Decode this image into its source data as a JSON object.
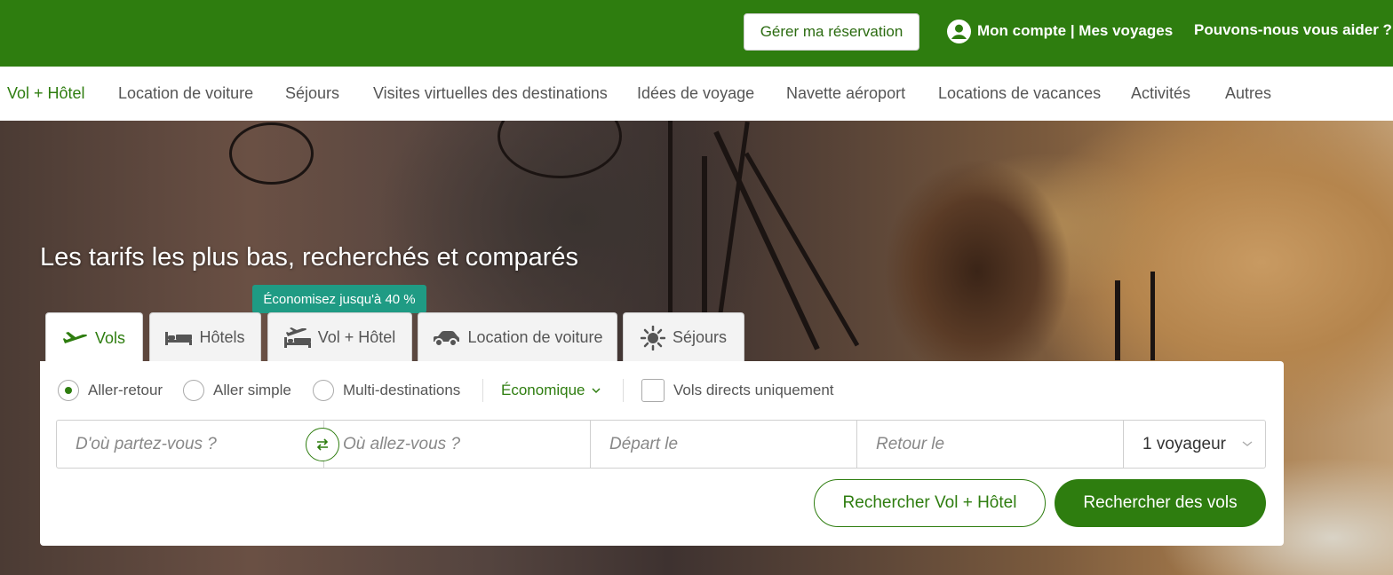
{
  "header": {
    "manage_booking": "Gérer ma réservation",
    "account": "Mon compte | Mes voyages",
    "help": "Pouvons-nous vous aider ?"
  },
  "nav": {
    "items": [
      "Vol + Hôtel",
      "Location de voiture",
      "Séjours",
      "Visites virtuelles des destinations",
      "Idées de voyage",
      "Navette aéroport",
      "Locations de vacances",
      "Activités",
      "Autres"
    ]
  },
  "hero": {
    "title": "Les tarifs les plus bas, recherchés et comparés"
  },
  "tabs": {
    "promo": "Économisez jusqu'à 40 %",
    "items": [
      {
        "label": "Vols",
        "icon": "plane-icon",
        "active": true
      },
      {
        "label": "Hôtels",
        "icon": "bed-icon",
        "active": false
      },
      {
        "label": "Vol + Hôtel",
        "icon": "plane-bed-icon",
        "active": false
      },
      {
        "label": "Location de voiture",
        "icon": "car-icon",
        "active": false
      },
      {
        "label": "Séjours",
        "icon": "sun-icon",
        "active": false
      }
    ]
  },
  "search": {
    "trip_types": [
      "Aller-retour",
      "Aller simple",
      "Multi-destinations"
    ],
    "selected_trip_type": "Aller-retour",
    "cabin_class": "Économique",
    "direct_only": "Vols directs uniquement",
    "from_placeholder": "D'où partez-vous ?",
    "to_placeholder": "Où allez-vous ?",
    "depart_placeholder": "Départ le",
    "return_placeholder": "Retour le",
    "travelers": "1 voyageur",
    "search_package": "Rechercher Vol + Hôtel",
    "search_flights": "Rechercher des vols"
  },
  "colors": {
    "brand_green": "#2e7d0f",
    "promo_teal": "#1f9b84"
  }
}
